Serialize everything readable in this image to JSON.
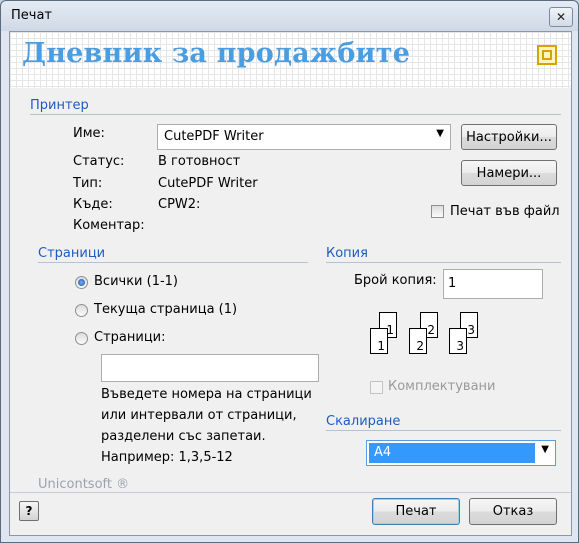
{
  "window": {
    "title": "Печат",
    "close_label": "✕"
  },
  "banner": {
    "title": "Дневник за продажбите"
  },
  "printer": {
    "heading": "Принтер",
    "name_label": "Име:",
    "name_value": "CutePDF Writer",
    "status_label": "Статус:",
    "status_value": "В готовност",
    "type_label": "Тип:",
    "type_value": "CutePDF Writer",
    "where_label": "Къде:",
    "where_value": "CPW2:",
    "comment_label": "Коментар:",
    "settings_button": "Настройки...",
    "find_button": "Намери...",
    "print_to_file_label": "Печат във файл"
  },
  "pages": {
    "heading": "Страници",
    "all_label": "Всички (1-1)",
    "current_label": "Текуща страница (1)",
    "pages_label": "Страници:",
    "range_value": "",
    "hint": [
      "Въведете номера на страници",
      "или интервали от страници,",
      "разделени със запетаи.",
      "Например: 1,3,5-12"
    ]
  },
  "copies": {
    "heading": "Копия",
    "count_label": "Брой копия:",
    "count_value": "1",
    "collate_label": "Комплектувани",
    "page_numbers": [
      "1",
      "1",
      "2",
      "2",
      "3",
      "3"
    ]
  },
  "scaling": {
    "heading": "Скалиране",
    "value": "A4"
  },
  "footer": {
    "brand": "Unicontsoft ®",
    "help_label": "?",
    "print_button": "Печат",
    "cancel_button": "Отказ"
  },
  "colors": {
    "heading": "#1f5bbf",
    "banner_title": "#4a9de0",
    "selection": "#3399ff"
  }
}
